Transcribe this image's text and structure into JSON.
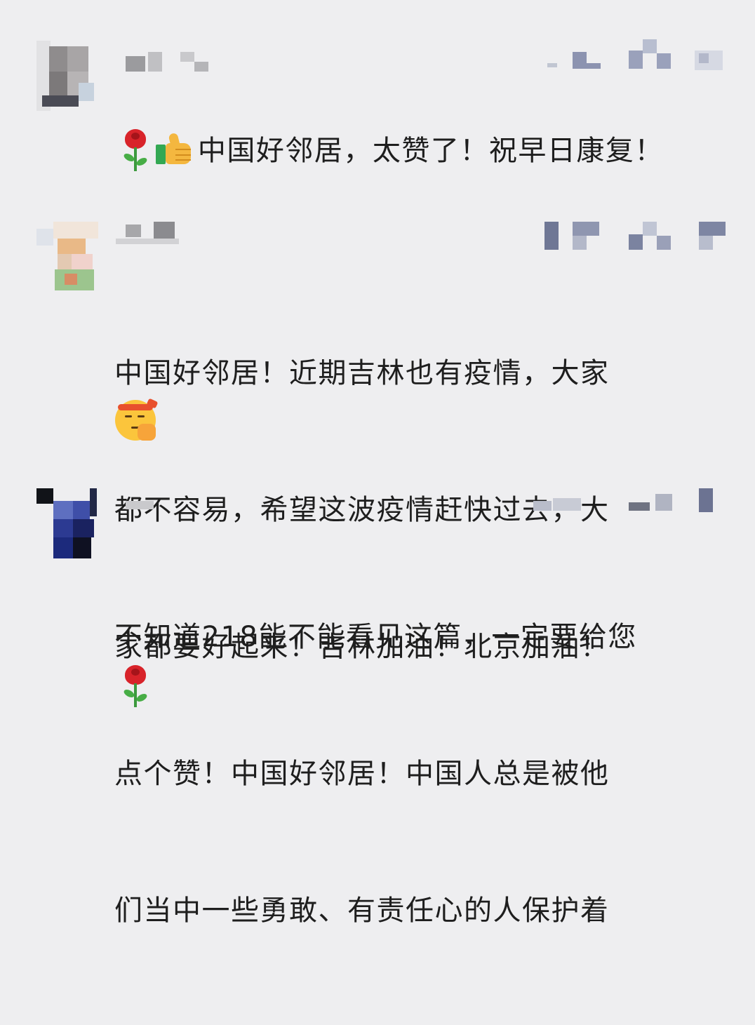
{
  "comments": [
    {
      "text": "中国好邻居，太赞了！祝早日康复！",
      "leading_emoji": "thumbs-up",
      "trailing_emoji": "rose"
    },
    {
      "text_lines": [
        "中国好邻居！近期吉林也有疫情，大家",
        "都不容易，希望这波疫情赶快过去，大",
        "家都要好起来！吉林加油！北京加油！"
      ],
      "trailing_emoji": "determined-face-with-headband"
    },
    {
      "text_lines": [
        "不知道218能不能看见这篇，一定要给您",
        "点个赞！中国好邻居！中国人总是被他",
        "们当中一些勇敢、有责任心的人保护着"
      ],
      "trailing_emoji": "rose"
    }
  ],
  "colors": {
    "background": "#eeeef0",
    "text": "#1e1e1e"
  }
}
